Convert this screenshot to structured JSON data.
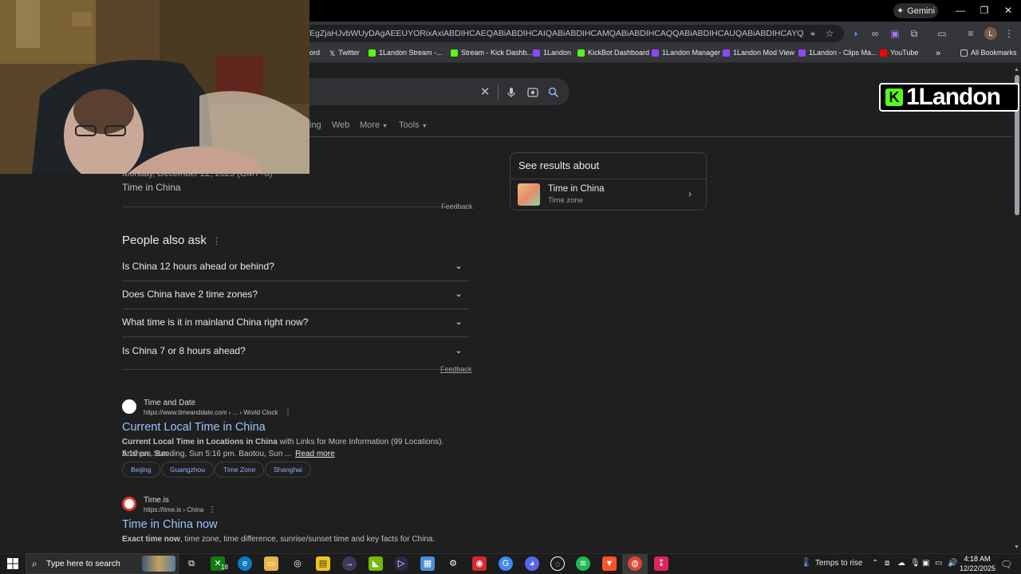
{
  "browser": {
    "gemini_label": "Gemini",
    "url": "EgZjaHJvbWUyDAgAEEUYORixAxiABDIHCAEQABiABDIHCAIQABiABDIHCAMQABiABDIHCAQQABiABDIHCAUQABiABDIHCAYQABiABDIHCAcQABiABD...",
    "bookmarks": [
      {
        "label": "ord",
        "color": "#35363a"
      },
      {
        "label": "Twitter",
        "color": "#000000"
      },
      {
        "label": "1Landon Stream -...",
        "color": "#53fc18"
      },
      {
        "label": "Stream - Kick Dashb...",
        "color": "#53fc18"
      },
      {
        "label": "1Landon",
        "color": "#9146ff"
      },
      {
        "label": "KickBot Dashboard",
        "color": "#53fc18"
      },
      {
        "label": "1Landon Manager",
        "color": "#9146ff"
      },
      {
        "label": "1Landon Mod View",
        "color": "#9146ff"
      },
      {
        "label": "1Landon - Clips Ma...",
        "color": "#9146ff"
      },
      {
        "label": "YouTube",
        "color": "#ff0000"
      }
    ],
    "all_bookmarks": "All Bookmarks",
    "more_bookmarks": "»"
  },
  "search": {
    "tabs": [
      "ing",
      "Web",
      "More",
      "Tools"
    ]
  },
  "overlay": {
    "logo_k": "K",
    "logo_text": "1Landon"
  },
  "results": {
    "date_line": "Monday, December 22, 2025 (GMT+8)",
    "time_label": "Time in China",
    "feedback": "Feedback",
    "paa_title": "People also ask",
    "paa": [
      "Is China 12 hours ahead or behind?",
      "Does China have 2 time zones?",
      "What time is it in mainland China right now?",
      "Is China 7 or 8 hours ahead?"
    ],
    "r1": {
      "site": "Time and Date",
      "url": "https://www.timeanddate.com › ... › World Clock",
      "title": "Current Local Time in China",
      "snippet_bold": "Current Local Time in Locations in China",
      "snippet_rest": " with Links for More Information (99 Locations). Anshan, Sun",
      "snippet_line2": "5:16 pm. Baoding, Sun 5:16 pm. Baotou, Sun ...",
      "read_more": "Read more",
      "chips": [
        "Beijing",
        "Guangzhou",
        "Time Zone",
        "Shanghai"
      ]
    },
    "r2": {
      "site": "Time.is",
      "url": "https://time.is › China",
      "title": "Time in China now",
      "snippet_bold": "Exact time now",
      "snippet_rest": ", time zone, time difference, sunrise/sunset time and key facts for China."
    }
  },
  "knowledge_panel": {
    "header": "See results about",
    "item_title": "Time in China",
    "item_sub": "Time zone"
  },
  "taskbar": {
    "search_placeholder": "Type here to search",
    "weather": "Temps to rise",
    "time": "4:18 AM",
    "date": "12/22/2025",
    "badge": "18"
  }
}
